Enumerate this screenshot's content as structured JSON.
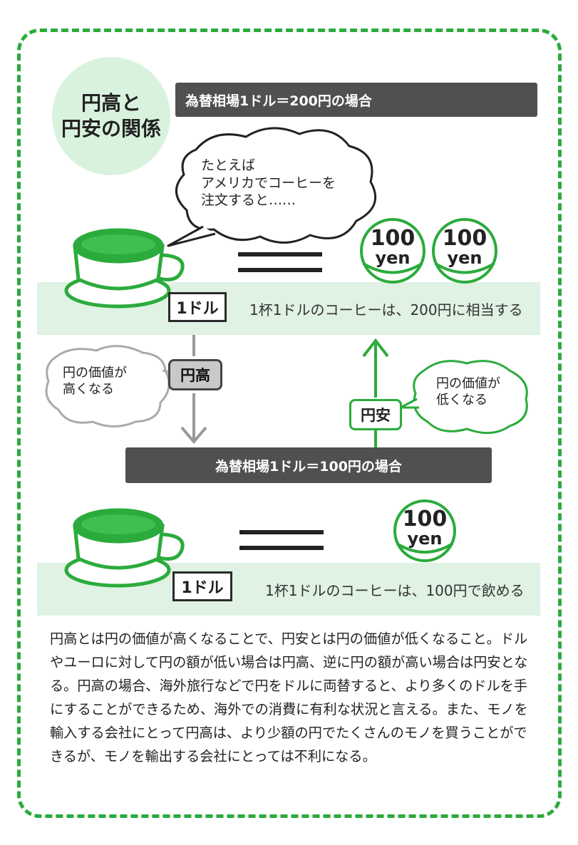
{
  "title": "円高と\n円安の関係",
  "scenario1": {
    "header": "為替相場1ドル＝200円の場合",
    "speech": "たとえば\nアメリカでコーヒーを\n注文すると……",
    "price_tag": "1ドル",
    "coins": [
      {
        "amount": "100",
        "unit": "yen"
      },
      {
        "amount": "100",
        "unit": "yen"
      }
    ],
    "caption": "1杯1ドルのコーヒーは、200円に相当する"
  },
  "transition": {
    "yendaka": {
      "label": "円高",
      "bubble": "円の価値が\n高くなる"
    },
    "yenyasu": {
      "label": "円安",
      "bubble": "円の価値が\n低くなる"
    }
  },
  "scenario2": {
    "header": "為替相場1ドル＝100円の場合",
    "price_tag": "1ドル",
    "coins": [
      {
        "amount": "100",
        "unit": "yen"
      }
    ],
    "caption": "1杯1ドルのコーヒーは、100円で飲める"
  },
  "explanation": "円高とは円の価値が高くなることで、円安とは円の価値が低くなること。ドルやユーロに対して円の額が低い場合は円高、逆に円の額が高い場合は円安となる。円高の場合、海外旅行などで円をドルに両替すると、より多くのドルを手にすることができるため、海外での消費に有利な状況と言える。また、モノを輸入する会社にとって円高は、より少額の円でたくさんのモノを買うことができるが、モノを輸出する会社にとっては不利になる。",
  "colors": {
    "frame_green": "#2bab3c",
    "band_mint": "#dff2e3",
    "title_circle": "#d9f2de",
    "dark_bar": "#505050",
    "coffee_green": "#2bab3c"
  },
  "icons": [
    "coffee-cup-icon",
    "yen-coin-icon",
    "down-arrow-icon",
    "up-arrow-icon",
    "equals-sign-icon",
    "speech-bubble-icon"
  ]
}
